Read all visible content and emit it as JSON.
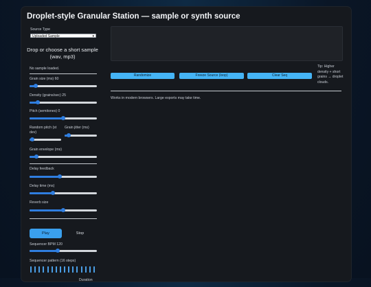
{
  "app": {
    "title": "Droplet-style Granular Station — sample or synth source"
  },
  "source": {
    "label": "Source Type",
    "selected": "Uploaded Sample",
    "drop_text": "Drop or choose a short sample (wav, mp3)",
    "status": "No sample loaded."
  },
  "controls": {
    "grain_size": {
      "label": "Grain size (ms) 60",
      "fraction": 0.09
    },
    "density": {
      "label": "Density (grains/sec) 25",
      "fraction": 0.12
    },
    "pitch": {
      "label": "Pitch (semitones) 0",
      "fraction": 0.5
    },
    "random_pitch": {
      "label": "Random pitch (st dev)",
      "fraction": 0.08
    },
    "grain_jitter": {
      "label": "Grain jitter (ms)",
      "fraction": 0.12
    },
    "grain_envelope": {
      "label": "Grain envelope (ms)",
      "fraction": 0.1
    },
    "delay_feedback": {
      "label": "Delay feedback",
      "fraction": 0.45
    },
    "delay_time": {
      "label": "Delay time (ms)",
      "fraction": 0.35
    },
    "reverb_size": {
      "label": "Reverb size",
      "fraction": 0.5
    },
    "bpm": {
      "label": "Sequencer BPM 120",
      "fraction": 0.42
    }
  },
  "transport": {
    "play_label": "Play",
    "stop_label": "Stop"
  },
  "sequencer": {
    "label": "Sequencer pattern (16 steps)",
    "steps": 16,
    "duration_label": "Duration"
  },
  "actions": {
    "randomize": "Randomize",
    "freeze": "Freeze Source (loop)",
    "clear": "Clear Seq"
  },
  "tip": "Tip: Higher density + short grains → droplet clouds.",
  "note": "Works in modern browsers. Large exports may take time.",
  "colors": {
    "accent": "#2f7ee0",
    "button": "#45b4f5",
    "background": "#16191e"
  }
}
